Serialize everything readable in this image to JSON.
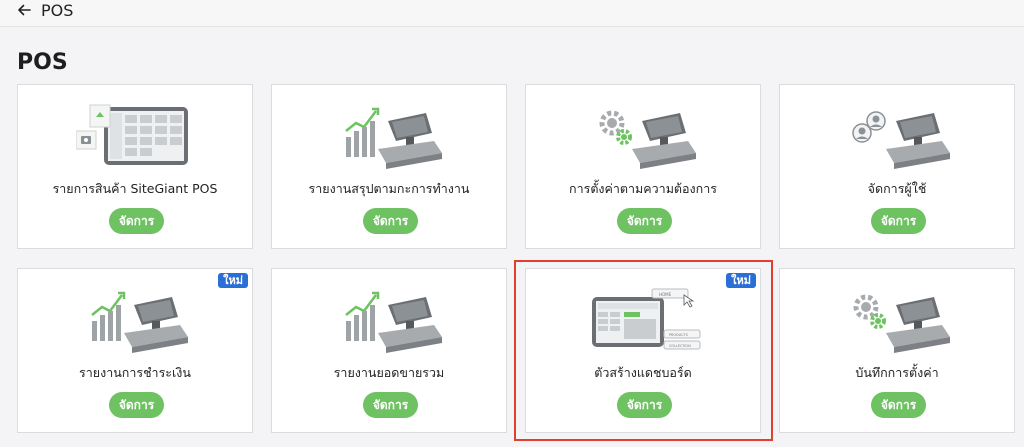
{
  "header": {
    "back_icon": "arrow-left-icon",
    "title": "POS"
  },
  "page": {
    "title": "POS"
  },
  "cards": [
    {
      "label": "รายการสินค้า SiteGiant POS",
      "button": "จัดการ",
      "icon": "tablet-products-illustration",
      "badge": ""
    },
    {
      "label": "รายงานสรุปตามกะการทำงาน",
      "button": "จัดการ",
      "icon": "chart-register-illustration",
      "badge": ""
    },
    {
      "label": "การตั้งค่าตามความต้องการ",
      "button": "จัดการ",
      "icon": "gear-register-illustration",
      "badge": ""
    },
    {
      "label": "จัดการผู้ใช้",
      "button": "จัดการ",
      "icon": "users-register-illustration",
      "badge": ""
    },
    {
      "label": "รายงานการชำระเงิน",
      "button": "จัดการ",
      "icon": "chart-register-illustration",
      "badge": "ใหม่"
    },
    {
      "label": "รายงานยอดขายรวม",
      "button": "จัดการ",
      "icon": "chart-register-illustration",
      "badge": ""
    },
    {
      "label": "ตัวสร้างแดชบอร์ด",
      "button": "จัดการ",
      "icon": "dashboard-builder-illustration",
      "badge": "ใหม่",
      "menu": [
        "HOME",
        "PRODUCTS",
        "COLLECTION"
      ]
    },
    {
      "label": "บันทึกการตั้งค่า",
      "button": "จัดการ",
      "icon": "gear-register-illustration",
      "badge": ""
    }
  ],
  "colors": {
    "button": "#6ec262",
    "badge": "#2b6fd6",
    "highlight": "#e0402f"
  }
}
